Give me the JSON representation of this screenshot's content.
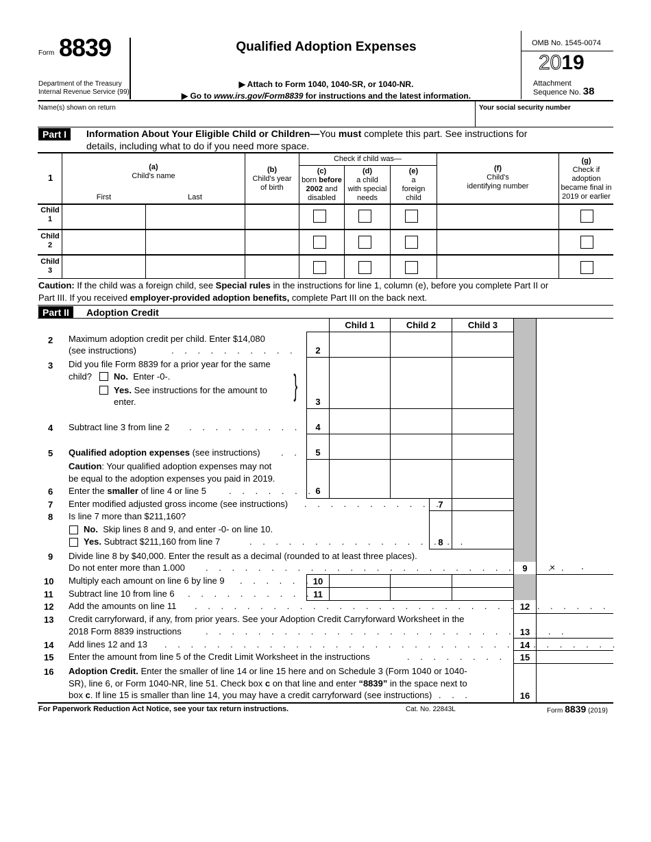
{
  "header": {
    "form_prefix": "Form",
    "form_number": "8839",
    "dept_line1": "Department of the Treasury",
    "dept_line2": "Internal Revenue Service (99)",
    "title": "Qualified Adoption Expenses",
    "attach_line": "▶ Attach to Form 1040, 1040-SR, or 1040-NR.",
    "goto_prefix": "▶ Go to ",
    "goto_url": "www.irs.gov/Form8839",
    "goto_suffix": " for instructions and the latest information.",
    "omb": "OMB No. 1545-0074",
    "year_outline": "20",
    "year_bold": "19",
    "attachment_label": "Attachment",
    "sequence_label": "Sequence No.",
    "sequence_no": "38"
  },
  "identity": {
    "name_label": "Name(s) shown on return",
    "name_value": "",
    "ssn_label": "Your social security number",
    "ssn_value": ""
  },
  "part1": {
    "label": "Part I",
    "title_bold": "Information About Your Eligible Child or Children—",
    "title_rest1": "You ",
    "title_must": "must",
    "title_rest2": " complete this part. See instructions for",
    "title_line2": "details, including what to do if you need more space.",
    "line_num": "1",
    "check_header": "Check if child was—",
    "columns": {
      "a_letter": "(a)",
      "a_label": "Child's name",
      "a_first": "First",
      "a_last": "Last",
      "b_letter": "(b)",
      "b_line1": "Child's year",
      "b_line2": "of birth",
      "c_letter": "(c)",
      "c_line1a": "born ",
      "c_line1b": "before",
      "c_line2a": "2002",
      "c_line2b": " and",
      "c_line3": "disabled",
      "d_letter": "(d)",
      "d_line1": "a child",
      "d_line2": "with special",
      "d_line3": "needs",
      "e_letter": "(e)",
      "e_line1": "a",
      "e_line2": "foreign",
      "e_line3": "child",
      "f_letter": "(f)",
      "f_line1": "Child's",
      "f_line2": "identifying number",
      "g_letter": "(g)",
      "g_line1": "Check if",
      "g_line2": "adoption",
      "g_line3": "became final in",
      "g_line4": "2019 or earlier"
    },
    "rows": [
      {
        "label1": "Child",
        "label2": "1",
        "first": "",
        "last": "",
        "year": "",
        "c": false,
        "d": false,
        "e": false,
        "id": "",
        "g": false
      },
      {
        "label1": "Child",
        "label2": "2",
        "first": "",
        "last": "",
        "year": "",
        "c": false,
        "d": false,
        "e": false,
        "id": "",
        "g": false
      },
      {
        "label1": "Child",
        "label2": "3",
        "first": "",
        "last": "",
        "year": "",
        "c": false,
        "d": false,
        "e": false,
        "id": "",
        "g": false
      }
    ],
    "caution_bold": "Caution:",
    "caution_t1": " If the child was a foreign child, see ",
    "caution_b2": "Special rules",
    "caution_t2": " in the instructions for line 1, column (e), before you complete Part II or",
    "caution_t3": "Part III. If you received ",
    "caution_b3": "employer-provided adoption benefits,",
    "caution_t4": " complete Part III on the back next."
  },
  "part2": {
    "label": "Part II",
    "title": "Adoption Credit",
    "col_headers": [
      "Child 1",
      "Child 2",
      "Child 3"
    ],
    "lines": {
      "l2_num": "2",
      "l2_t1": "Maximum adoption credit per child. Enter $14,080",
      "l2_t2": "(see instructions)",
      "l3_num": "3",
      "l3_t1": "Did you file Form 8839 for a prior year for the same",
      "l3_t2": "child?",
      "l3_no_b": "No.",
      "l3_no_t": "Enter -0-.",
      "l3_yes_b": "Yes.",
      "l3_yes_t": "See instructions for the amount to",
      "l3_yes_t2": "enter.",
      "l4_num": "4",
      "l4_t": "Subtract line 3 from line 2",
      "l5_num": "5",
      "l5_b": "Qualified adoption expenses",
      "l5_t": " (see instructions)",
      "l5_caution_b": "Caution",
      "l5_caution_t": ": Your qualified adoption expenses may not",
      "l5_caution_t2": "be equal to the adoption expenses you paid in 2019.",
      "l6_num": "6",
      "l6_t1": "Enter the ",
      "l6_b": "smaller",
      "l6_t2": " of line 4 or line 5",
      "l7_num": "7",
      "l7_t": "Enter modified adjusted gross income (see instructions)",
      "l8_num": "8",
      "l8_t": "Is line 7 more than $211,160?",
      "l8_no_b": "No.",
      "l8_no_t": "Skip lines 8 and 9, and enter -0- on line 10.",
      "l8_yes_b": "Yes.",
      "l8_yes_t": "Subtract $211,160 from line 7",
      "l9_num": "9",
      "l9_t1": "Divide line 8 by $40,000. Enter the result as a decimal (rounded to at least three places).",
      "l9_t2": "Do not enter more than 1.000",
      "l9_x": "×",
      "l9_dot": ".",
      "l10_num": "10",
      "l10_t": "Multiply each amount on line 6 by line 9",
      "l11_num": "11",
      "l11_t": "Subtract line 10 from line 6",
      "l12_num": "12",
      "l12_t": "Add the amounts on line 11",
      "l13_num": "13",
      "l13_t1": "Credit carryforward, if any, from prior years. See your Adoption Credit Carryforward Worksheet in the",
      "l13_t2": "2018 Form 8839 instructions",
      "l14_num": "14",
      "l14_t": "Add lines 12 and 13",
      "l15_num": "15",
      "l15_t": "Enter the amount from line 5 of the Credit Limit Worksheet in the instructions",
      "l16_num": "16",
      "l16_b": "Adoption Credit.",
      "l16_t1": " Enter the smaller of line 14 or line 15 here and on Schedule 3 (Form 1040 or 1040-",
      "l16_t2a": "SR), line 6, or Form 1040-NR, line 51. Check box ",
      "l16_c": "c",
      "l16_t2b": " on that line and enter ",
      "l16_q": "“8839”",
      "l16_t2c": " in the space next to",
      "l16_t3a": "box ",
      "l16_c2": "c",
      "l16_t3b": ". If line 15 is smaller than line 14, you may have a credit carryforward (see instructions)"
    },
    "values": {
      "l2": [
        "",
        "",
        ""
      ],
      "l3": [
        "",
        "",
        ""
      ],
      "l4": [
        "",
        "",
        ""
      ],
      "l5": [
        "",
        "",
        ""
      ],
      "l6": [
        "",
        "",
        ""
      ],
      "l7": "",
      "l8": "",
      "l9": "",
      "l10": [
        "",
        "",
        ""
      ],
      "l11": [
        "",
        "",
        ""
      ],
      "l12": "",
      "l13": "",
      "l14": "",
      "l15": "",
      "l16": ""
    }
  },
  "footer": {
    "paperwork": "For Paperwork Reduction Act Notice, see your tax return instructions.",
    "cat_no": "Cat. No. 22843L",
    "form_prefix": "Form",
    "form_number": "8839",
    "form_year": "(2019)"
  },
  "colors": {
    "shade": "#c0c0c0",
    "ink": "#000000"
  }
}
